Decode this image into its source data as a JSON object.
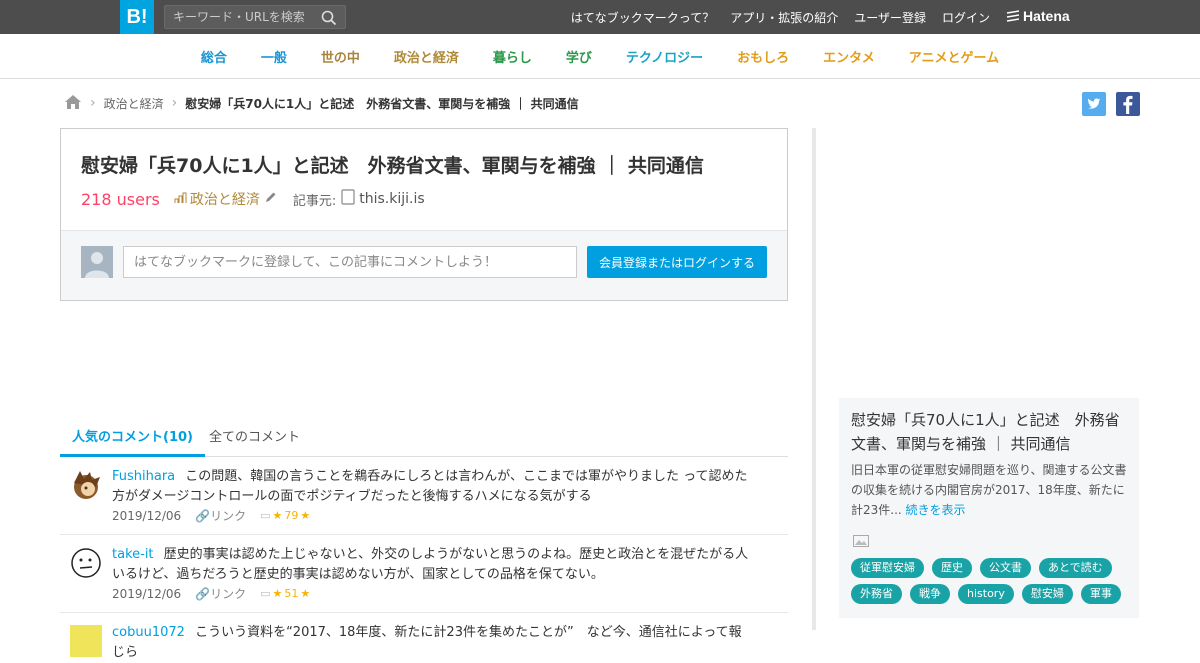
{
  "header": {
    "logo": "B!",
    "search_placeholder": "キーワード・URLを検索",
    "links": [
      "はてなブックマークって？",
      "アプリ・拡張の紹介",
      "ユーザー登録",
      "ログイン"
    ],
    "brand": "Hatena"
  },
  "categories": [
    {
      "label": "総合",
      "color": "#1a95d4"
    },
    {
      "label": "一般",
      "color": "#1a95d4"
    },
    {
      "label": "世の中",
      "color": "#a8843c"
    },
    {
      "label": "政治と経済",
      "color": "#b08a3a"
    },
    {
      "label": "暮らし",
      "color": "#2a9a4a"
    },
    {
      "label": "学び",
      "color": "#2a9a4a"
    },
    {
      "label": "テクノロジー",
      "color": "#1aa3c3"
    },
    {
      "label": "おもしろ",
      "color": "#e39c1a"
    },
    {
      "label": "エンタメ",
      "color": "#e39c1a"
    },
    {
      "label": "アニメとゲーム",
      "color": "#e39c1a"
    }
  ],
  "breadcrumb": {
    "category": "政治と経済",
    "current": "慰安婦「兵70人に1人」と記述　外務省文書、軍関与を補強 ｜ 共同通信"
  },
  "entry": {
    "title": "慰安婦「兵70人に1人」と記述　外務省文書、軍関与を補強 ｜ 共同通信",
    "users": "218 users",
    "category": "政治と経済",
    "source_label": "記事元:",
    "source_domain": "this.kiji.is",
    "comment_placeholder": "はてなブックマークに登録して、この記事にコメントしよう！",
    "login_button": "会員登録またはログインする"
  },
  "tabs": {
    "popular": "人気のコメント(10)",
    "all": "全てのコメント"
  },
  "comments": [
    {
      "user": "Fushihara",
      "text": "この問題、韓国の言うことを鵜呑みにしろとは言わんが、ここまでは軍がやりました って認めた方がダメージコントロールの面でポジティブだったと後悔するハメになる気がする",
      "date": "2019/12/06",
      "link": "リンク",
      "stars": "79"
    },
    {
      "user": "take-it",
      "text": "歴史的事実は認めた上じゃないと、外交のしようがないと思うのよね。歴史と政治とを混ぜたがる人いるけど、過ちだろうと歴史的事実は認めない方が、国家としての品格を保てない。",
      "date": "2019/12/06",
      "link": "リンク",
      "stars": "51"
    },
    {
      "user": "cobuu1072",
      "text": "こういう資料を“2017、18年度、新たに計23件を集めたことが”　など今、通信社によって報じら",
      "date": "",
      "link": "",
      "stars": ""
    }
  ],
  "sidebar": {
    "title": "慰安婦「兵70人に1人」と記述　外務省文書、軍関与を補強 ｜ 共同通信",
    "summary": "旧日本軍の従軍慰安婦問題を巡り、関連する公文書の収集を続ける内閣官房が2017、18年度、新たに計23件...",
    "more": "続きを表示",
    "tags": [
      "従軍慰安婦",
      "歴史",
      "公文書",
      "あとで読む",
      "外務省",
      "戦争",
      "history",
      "慰安婦",
      "軍事"
    ]
  }
}
